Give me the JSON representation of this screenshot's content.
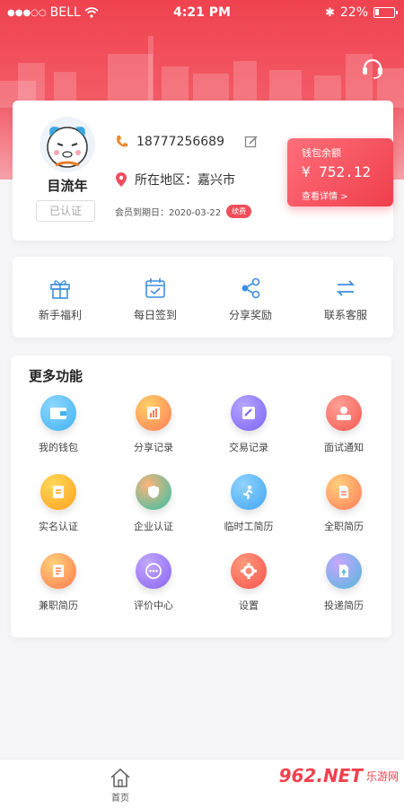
{
  "status": {
    "carrier": "BELL",
    "time": "4:21 PM",
    "battery": "22%"
  },
  "profile": {
    "name": "目流年",
    "verified": "已认证",
    "phone": "18777256689",
    "location": "所在地区：嘉兴市",
    "member_expiry": "会员到期日：2020-03-22",
    "renew": "续费"
  },
  "wallet": {
    "title": "钱包余额",
    "amount": "¥ 752.12",
    "detail": "查看详情 >"
  },
  "quick": [
    {
      "label": "新手福利",
      "icon": "gift-icon"
    },
    {
      "label": "每日签到",
      "icon": "calendar-check-icon"
    },
    {
      "label": "分享奖励",
      "icon": "share-icon"
    },
    {
      "label": "联系客服",
      "icon": "swap-arrows-icon"
    }
  ],
  "more": {
    "title": "更多功能",
    "items": [
      {
        "label": "我的钱包",
        "icon": "wallet-icon",
        "color": "#3fb3f0"
      },
      {
        "label": "分享记录",
        "icon": "chart-icon",
        "color": "#ff8a5c"
      },
      {
        "label": "交易记录",
        "icon": "edit-icon",
        "color": "#7b63f5"
      },
      {
        "label": "面试通知",
        "icon": "person-card-icon",
        "color": "#f5574f"
      },
      {
        "label": "实名认证",
        "icon": "id-card-icon",
        "color": "#ffae21"
      },
      {
        "label": "企业认证",
        "icon": "shield-icon",
        "color": "#2ec1a6"
      },
      {
        "label": "临时工简历",
        "icon": "person-run-icon",
        "color": "#3fa6f0"
      },
      {
        "label": "全职简历",
        "icon": "document-icon",
        "color": "#ff7a58"
      },
      {
        "label": "兼职简历",
        "icon": "resume-icon",
        "color": "#ff7a4f"
      },
      {
        "label": "评价中心",
        "icon": "chat-dots-icon",
        "color": "#8a62f0"
      },
      {
        "label": "设置",
        "icon": "gear-icon",
        "color": "#f5514d"
      },
      {
        "label": "投递简历",
        "icon": "file-send-icon",
        "color": "#4fb8d8"
      }
    ]
  },
  "bottom": {
    "home": "首页",
    "watermark": "962.NET",
    "watermark_sub": "乐游网"
  }
}
